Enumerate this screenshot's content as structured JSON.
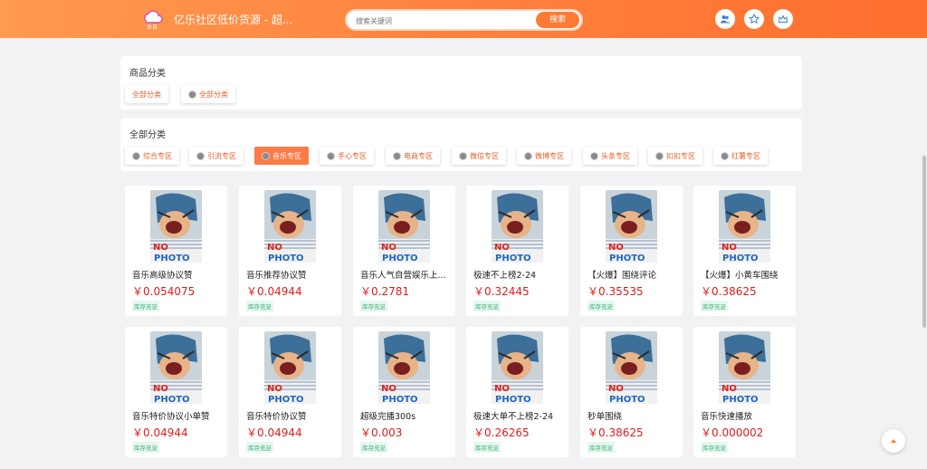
{
  "header": {
    "logo_text": "沐自",
    "site_title": "亿乐社区低价货源 - 超...",
    "search_placeholder": "搜索关键词",
    "search_button": "搜索",
    "icons": [
      "users-icon",
      "star-icon",
      "crown-icon"
    ]
  },
  "category_panel": {
    "title": "商品分类",
    "chips": [
      "全部分类",
      "全部分类"
    ]
  },
  "subcategory_panel": {
    "title": "全部分类",
    "chips": [
      "综合专区",
      "引流专区",
      "音乐专区",
      "手心专区",
      "电商专区",
      "微信专区",
      "微博专区",
      "头条专区",
      "扣扣专区",
      "红薯专区"
    ],
    "active_index": 2
  },
  "products": [
    {
      "name": "音乐高级协议赞",
      "price": "￥0.054075",
      "stock": "库存充足"
    },
    {
      "name": "音乐推荐协议赞",
      "price": "￥0.04944",
      "stock": "库存充足"
    },
    {
      "name": "音乐人气自营娱乐上...",
      "price": "￥0.2781",
      "stock": "库存充足"
    },
    {
      "name": "极速不上榜2-24",
      "price": "￥0.32445",
      "stock": "库存充足"
    },
    {
      "name": "【火爆】围绕评论",
      "price": "￥0.35535",
      "stock": "库存充足"
    },
    {
      "name": "【火爆】小黄车围绕",
      "price": "￥0.38625",
      "stock": "库存充足"
    },
    {
      "name": "音乐特价协议小单赞",
      "price": "￥0.04944",
      "stock": "库存充足"
    },
    {
      "name": "音乐特价协议赞",
      "price": "￥0.04944",
      "stock": "库存充足"
    },
    {
      "name": "超级完播300s",
      "price": "￥0.003",
      "stock": "库存充足"
    },
    {
      "name": "极速大单不上榜2-24",
      "price": "￥0.26265",
      "stock": "库存充足"
    },
    {
      "name": "秒单围绕",
      "price": "￥0.38625",
      "stock": "库存充足"
    },
    {
      "name": "音乐快速播放",
      "price": "￥0.000002",
      "stock": "库存充足"
    }
  ],
  "thumb_text": [
    "NO",
    "PHOTO"
  ],
  "colors": {
    "accent": "#ff7a35",
    "price": "#e31c1c",
    "stock": "#3bb27a"
  }
}
